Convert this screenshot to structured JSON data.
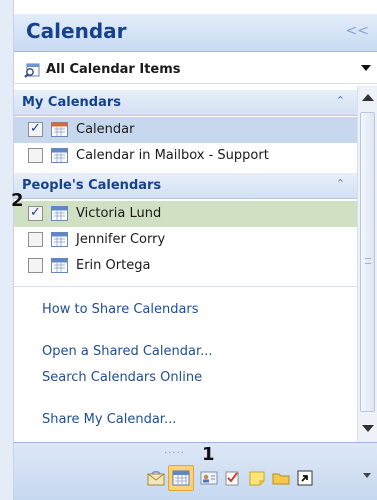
{
  "header": {
    "title": "Calendar",
    "collapse_glyph": "<<"
  },
  "view": {
    "label": "All Calendar Items"
  },
  "my_calendars": {
    "title": "My Calendars",
    "items": [
      {
        "label": "Calendar",
        "checked": true
      },
      {
        "label": "Calendar in Mailbox - Support",
        "checked": false
      }
    ]
  },
  "peoples_calendars": {
    "title": "People's Calendars",
    "items": [
      {
        "label": "Victoria Lund",
        "checked": true
      },
      {
        "label": "Jennifer Corry",
        "checked": false
      },
      {
        "label": "Erin Ortega",
        "checked": false
      }
    ]
  },
  "links": {
    "share_calendars": "How to Share Calendars",
    "open_shared": "Open a Shared Calendar...",
    "search_online": "Search Calendars Online",
    "share_my": "Share My Calendar..."
  },
  "annotations": {
    "one": "1",
    "two": "2"
  },
  "glyphs": {
    "check": "✓",
    "collapse_up": "⌃",
    "dots": "....."
  },
  "colors": {
    "accent": "#15428b",
    "link": "#1f4e96",
    "selected_blue": "#c7d7ee",
    "selected_green": "#cfe0c3",
    "active_nav": "#ffd27a"
  },
  "icons": {
    "view": "search-calendar-icon",
    "calendar": "calendar-icon",
    "nav": [
      "mail-icon",
      "calendar-icon",
      "contacts-icon",
      "tasks-icon",
      "notes-icon",
      "folder-icon",
      "shortcuts-icon"
    ]
  }
}
